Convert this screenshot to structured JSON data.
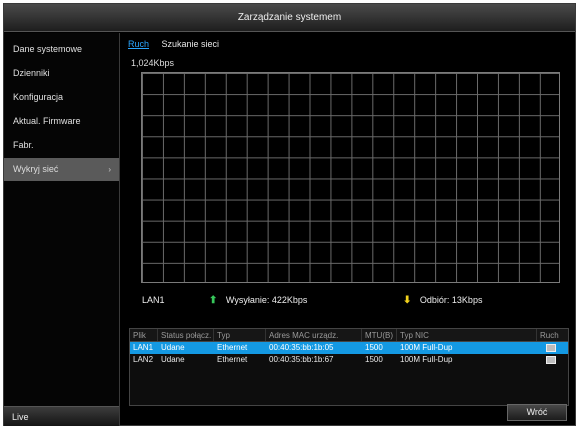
{
  "window": {
    "title": "Zarządzanie systemem"
  },
  "sidebar": {
    "items": [
      {
        "label": "Dane systemowe"
      },
      {
        "label": "Dzienniki"
      },
      {
        "label": "Konfiguracja"
      },
      {
        "label": "Aktual. Firmware"
      },
      {
        "label": "Fabr."
      },
      {
        "label": "Wykryj sieć",
        "chevron": "›"
      }
    ],
    "live_label": "Live"
  },
  "tabs": [
    {
      "label": "Ruch"
    },
    {
      "label": "Szukanie sieci"
    }
  ],
  "graph": {
    "max_rate": "1,024Kbps"
  },
  "legend": {
    "interface": "LAN1",
    "upload_arrow": "⬆",
    "upload": "Wysyłanie: 422Kbps",
    "download_arrow": "⬇",
    "download": "Odbiór: 13Kbps"
  },
  "table": {
    "headers": [
      "Plik",
      "Status połącz.",
      "Typ",
      "Adres MAC urządz.",
      "MTU(B)",
      "Typ NIC",
      "Ruch"
    ],
    "rows": [
      [
        "LAN1",
        "Udane",
        "Ethernet",
        "00:40:35:bb:1b:05",
        "1500",
        "100M Full-Dup"
      ],
      [
        "LAN2",
        "Udane",
        "Ethernet",
        "00:40:35:bb:1b:67",
        "1500",
        "100M Full-Dup"
      ]
    ]
  },
  "footer": {
    "back_label": "Wróć"
  },
  "colors": {
    "accent": "#1499e3",
    "upload": "#36c75a",
    "download": "#f2d21c"
  }
}
